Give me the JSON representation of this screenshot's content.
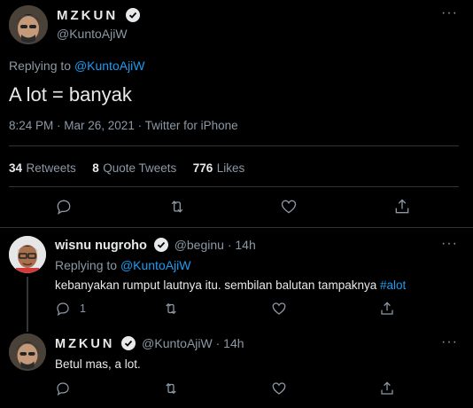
{
  "main_tweet": {
    "display_name": "MZKUN",
    "handle": "@KuntoAjiW",
    "replying_prefix": "Replying to",
    "replying_handle": "@KuntoAjiW",
    "text": "A lot = banyak",
    "meta": "8:24 PM · Mar 26, 2021 · Twitter for iPhone",
    "stats": {
      "retweets_num": "34",
      "retweets_label": "Retweets",
      "quotes_num": "8",
      "quotes_label": "Quote Tweets",
      "likes_num": "776",
      "likes_label": "Likes"
    },
    "more": "···"
  },
  "reply1": {
    "display_name": "wisnu nugroho",
    "handle": "@beginu",
    "time": "· 14h",
    "replying_prefix": "Replying to",
    "replying_handle": "@KuntoAjiW",
    "text": "kebanyakan rumput lautnya itu. sembilan balutan tampaknya",
    "hashtag": "#alot",
    "reply_count": "1",
    "more": "···"
  },
  "reply2": {
    "display_name": "MZKUN",
    "handle": "@KuntoAjiW",
    "time": "· 14h",
    "text": "Betul mas, a lot.",
    "more": "···"
  },
  "colors": {
    "background": "#000000",
    "accent": "#1d9bf0",
    "muted": "#8b98a5",
    "divider": "#2f3336"
  }
}
